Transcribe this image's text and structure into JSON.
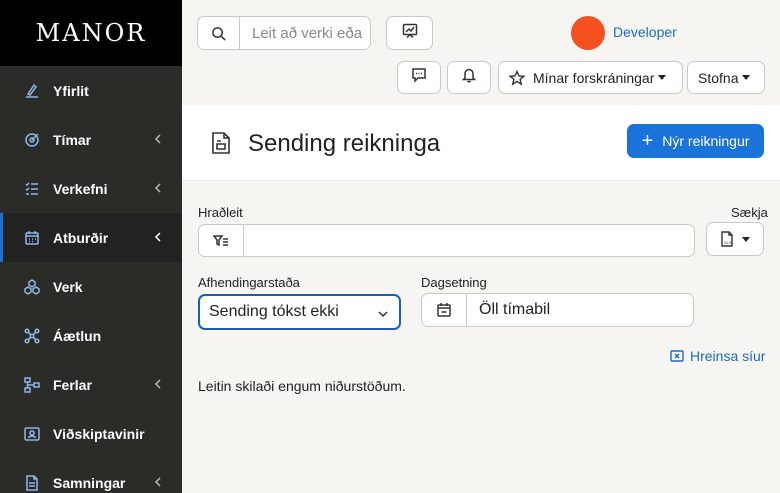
{
  "brand": {
    "logo": "MANOR"
  },
  "sidebar": {
    "items": [
      {
        "label": "Yfirlit",
        "icon": "chart-pen-icon",
        "has_submenu": false,
        "active": false
      },
      {
        "label": "Tímar",
        "icon": "clock-target-icon",
        "has_submenu": true,
        "active": false
      },
      {
        "label": "Verkefni",
        "icon": "checklist-icon",
        "has_submenu": true,
        "active": false
      },
      {
        "label": "Atburðir",
        "icon": "calendar-icon",
        "has_submenu": true,
        "active": true
      },
      {
        "label": "Verk",
        "icon": "cubes-icon",
        "has_submenu": false,
        "active": false
      },
      {
        "label": "Áætlun",
        "icon": "network-icon",
        "has_submenu": false,
        "active": false
      },
      {
        "label": "Ferlar",
        "icon": "flow-icon",
        "has_submenu": true,
        "active": false
      },
      {
        "label": "Viðskiptavinir",
        "icon": "customers-icon",
        "has_submenu": false,
        "active": false
      },
      {
        "label": "Samningar",
        "icon": "contract-icon",
        "has_submenu": true,
        "active": false
      }
    ]
  },
  "topbar": {
    "search_placeholder": "Leit að verki eða",
    "user_name": "Developer",
    "avatar_color": "#f5501f",
    "my_registrations_label": "Mínar forskráningar",
    "create_label": "Stofna"
  },
  "page": {
    "title": "Sending reikninga",
    "new_button_label": "Nýr reikningur"
  },
  "filters": {
    "quick_search_label": "Hraðleit",
    "quick_search_value": "",
    "fetch_label": "Sækja",
    "delivery_status_label": "Afhendingarstaða",
    "delivery_status_value": "Sending tókst ekki",
    "date_label": "Dagsetning",
    "date_value": "Öll tímabil",
    "clear_filters_label": "Hreinsa síur"
  },
  "results": {
    "empty_message": "Leitin skilaði engum niðurstöðum."
  },
  "colors": {
    "accent": "#1a73d9",
    "sidebar_bg": "#2b2b27",
    "logo_bg": "#000000",
    "link": "#1a6bc7"
  }
}
